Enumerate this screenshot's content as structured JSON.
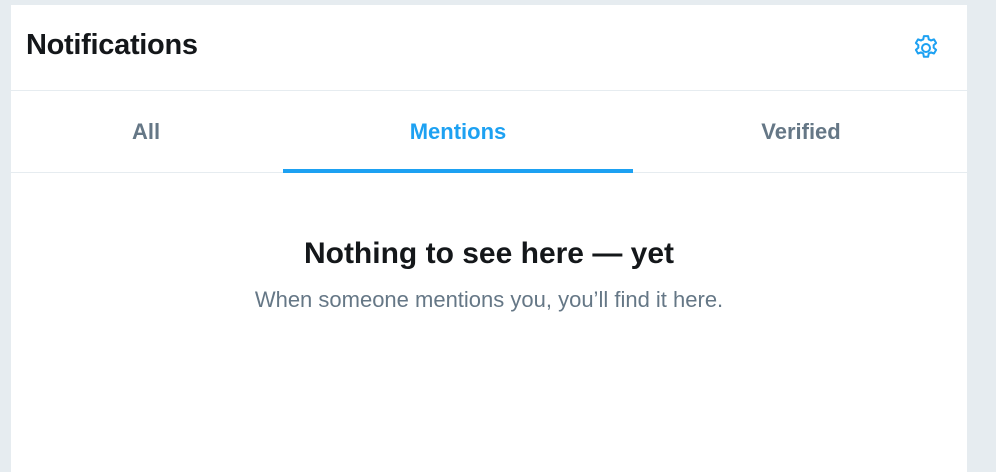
{
  "header": {
    "title": "Notifications",
    "settings_icon": "gear-icon"
  },
  "tabs": [
    {
      "label": "All",
      "active": false
    },
    {
      "label": "Mentions",
      "active": true
    },
    {
      "label": "Verified",
      "active": false
    }
  ],
  "empty_state": {
    "title": "Nothing to see here — yet",
    "subtitle": "When someone mentions you, you’ll find it here."
  },
  "colors": {
    "accent": "#1da1f2",
    "text_primary": "#14171a",
    "text_secondary": "#657786",
    "border": "#e6ecf0"
  }
}
